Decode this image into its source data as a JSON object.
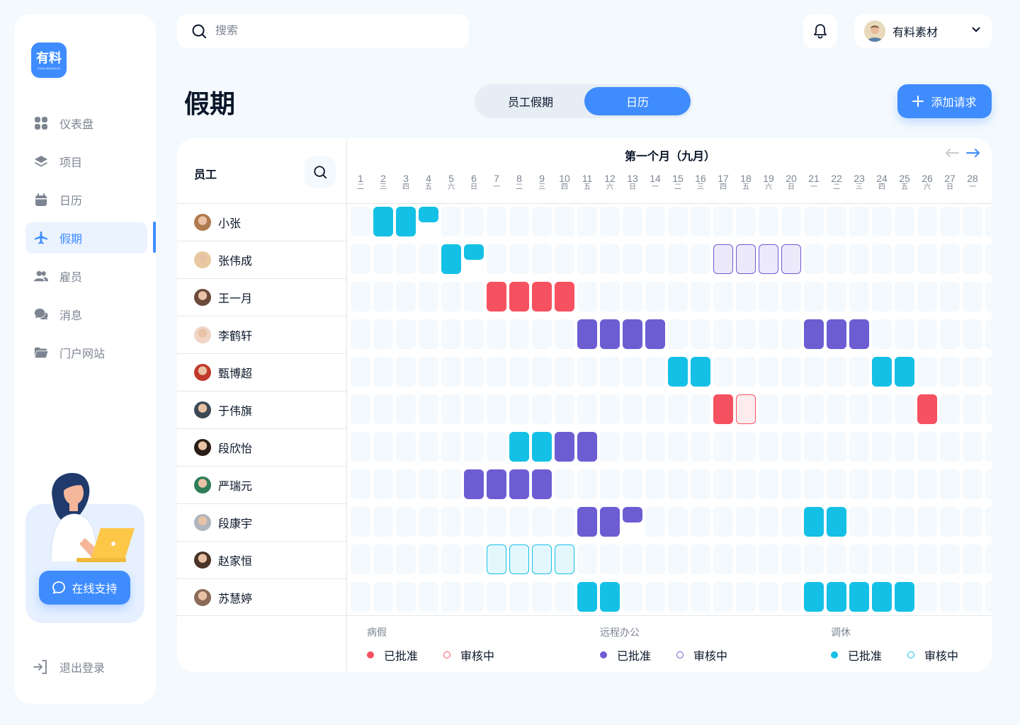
{
  "brand": {
    "name": "有料",
    "sub": "YOULIAOSUCAI"
  },
  "sidebar": {
    "items": [
      {
        "label": "仪表盘",
        "icon": "dashboard-icon"
      },
      {
        "label": "项目",
        "icon": "layers-icon"
      },
      {
        "label": "日历",
        "icon": "calendar-icon"
      },
      {
        "label": "假期",
        "icon": "plane-icon"
      },
      {
        "label": "雇员",
        "icon": "users-icon"
      },
      {
        "label": "消息",
        "icon": "chat-icon"
      },
      {
        "label": "门户网站",
        "icon": "folder-icon"
      }
    ],
    "active_index": 3,
    "support_label": "在线支持",
    "logout_label": "退出登录"
  },
  "search": {
    "placeholder": "搜索"
  },
  "profile": {
    "name": "有料素材"
  },
  "page": {
    "title": "假期",
    "tabs": [
      "员工假期",
      "日历"
    ],
    "active_tab": 1,
    "add_label": "添加请求"
  },
  "calendar": {
    "employee_header": "员工",
    "month_title": "第一个月（九月）",
    "days": [
      {
        "d": "1",
        "w": "二"
      },
      {
        "d": "2",
        "w": "三"
      },
      {
        "d": "3",
        "w": "四"
      },
      {
        "d": "4",
        "w": "五"
      },
      {
        "d": "5",
        "w": "六"
      },
      {
        "d": "6",
        "w": "日"
      },
      {
        "d": "7",
        "w": "一"
      },
      {
        "d": "8",
        "w": "二"
      },
      {
        "d": "9",
        "w": "三"
      },
      {
        "d": "10",
        "w": "四"
      },
      {
        "d": "11",
        "w": "五"
      },
      {
        "d": "12",
        "w": "六"
      },
      {
        "d": "13",
        "w": "日"
      },
      {
        "d": "14",
        "w": "一"
      },
      {
        "d": "15",
        "w": "二"
      },
      {
        "d": "16",
        "w": "三"
      },
      {
        "d": "17",
        "w": "四"
      },
      {
        "d": "18",
        "w": "五"
      },
      {
        "d": "19",
        "w": "六"
      },
      {
        "d": "20",
        "w": "日"
      },
      {
        "d": "21",
        "w": "一"
      },
      {
        "d": "22",
        "w": "二"
      },
      {
        "d": "23",
        "w": "三"
      },
      {
        "d": "24",
        "w": "四"
      },
      {
        "d": "25",
        "w": "五"
      },
      {
        "d": "26",
        "w": "六"
      },
      {
        "d": "27",
        "w": "日"
      },
      {
        "d": "28",
        "w": "一"
      },
      {
        "d": "2",
        "w": "二"
      }
    ],
    "employees": [
      {
        "name": "小张",
        "avatar_color": "#b07a4f",
        "leaves": [
          {
            "day": 2,
            "type": "off"
          },
          {
            "day": 3,
            "type": "off"
          },
          {
            "day": 4,
            "type": "off",
            "half": true
          }
        ]
      },
      {
        "name": "张伟成",
        "avatar_color": "#e8c9a0",
        "leaves": [
          {
            "day": 5,
            "type": "off"
          },
          {
            "day": 6,
            "type": "off",
            "half": true
          },
          {
            "day": 17,
            "type": "remote-p"
          },
          {
            "day": 18,
            "type": "remote-p"
          },
          {
            "day": 19,
            "type": "remote-p"
          },
          {
            "day": 20,
            "type": "remote-p"
          }
        ]
      },
      {
        "name": "王一月",
        "avatar_color": "#6b4a3a",
        "leaves": [
          {
            "day": 7,
            "type": "sick"
          },
          {
            "day": 8,
            "type": "sick"
          },
          {
            "day": 9,
            "type": "sick"
          },
          {
            "day": 10,
            "type": "sick"
          }
        ]
      },
      {
        "name": "李鹤轩",
        "avatar_color": "#f0d4c4",
        "leaves": [
          {
            "day": 11,
            "type": "remote"
          },
          {
            "day": 12,
            "type": "remote"
          },
          {
            "day": 13,
            "type": "remote"
          },
          {
            "day": 14,
            "type": "remote"
          },
          {
            "day": 21,
            "type": "remote"
          },
          {
            "day": 22,
            "type": "remote"
          },
          {
            "day": 23,
            "type": "remote"
          }
        ]
      },
      {
        "name": "甄博超",
        "avatar_color": "#c0392b",
        "leaves": [
          {
            "day": 15,
            "type": "off"
          },
          {
            "day": 16,
            "type": "off"
          },
          {
            "day": 24,
            "type": "off"
          },
          {
            "day": 25,
            "type": "off"
          }
        ]
      },
      {
        "name": "于伟旗",
        "avatar_color": "#3d4a55",
        "leaves": [
          {
            "day": 17,
            "type": "sick"
          },
          {
            "day": 18,
            "type": "sick-p"
          },
          {
            "day": 26,
            "type": "sick"
          }
        ]
      },
      {
        "name": "段欣怡",
        "avatar_color": "#2b1d18",
        "leaves": [
          {
            "day": 8,
            "type": "off"
          },
          {
            "day": 9,
            "type": "off"
          },
          {
            "day": 10,
            "type": "remote"
          },
          {
            "day": 11,
            "type": "remote"
          }
        ]
      },
      {
        "name": "严瑞元",
        "avatar_color": "#2f7d5a",
        "leaves": [
          {
            "day": 6,
            "type": "remote"
          },
          {
            "day": 7,
            "type": "remote"
          },
          {
            "day": 8,
            "type": "remote"
          },
          {
            "day": 9,
            "type": "remote"
          }
        ]
      },
      {
        "name": "段康宇",
        "avatar_color": "#b0b5bd",
        "leaves": [
          {
            "day": 11,
            "type": "remote"
          },
          {
            "day": 12,
            "type": "remote"
          },
          {
            "day": 13,
            "type": "remote",
            "half": true
          },
          {
            "day": 21,
            "type": "off"
          },
          {
            "day": 22,
            "type": "off"
          }
        ]
      },
      {
        "name": "赵家恒",
        "avatar_color": "#4a3427",
        "leaves": [
          {
            "day": 7,
            "type": "off-p"
          },
          {
            "day": 8,
            "type": "off-p"
          },
          {
            "day": 9,
            "type": "off-p"
          },
          {
            "day": 10,
            "type": "off-p"
          }
        ]
      },
      {
        "name": "苏慧婷",
        "avatar_color": "#8a6a58",
        "leaves": [
          {
            "day": 11,
            "type": "off"
          },
          {
            "day": 12,
            "type": "off"
          },
          {
            "day": 21,
            "type": "off"
          },
          {
            "day": 22,
            "type": "off"
          },
          {
            "day": 23,
            "type": "off"
          },
          {
            "day": 24,
            "type": "off"
          },
          {
            "day": 25,
            "type": "off"
          }
        ]
      }
    ]
  },
  "legend": [
    {
      "title": "病假",
      "color": "#f65160",
      "approved": "已批准",
      "pending": "审核中"
    },
    {
      "title": "远程办公",
      "color": "#6d5dd3",
      "approved": "已批准",
      "pending": "审核中"
    },
    {
      "title": "调休",
      "color": "#15c0e6",
      "approved": "已批准",
      "pending": "审核中"
    }
  ],
  "colors": {
    "accent": "#3f8cff",
    "sick": "#f65160",
    "remote": "#6d5dd3",
    "off": "#15c0e6",
    "background": "#f4f9fd"
  }
}
